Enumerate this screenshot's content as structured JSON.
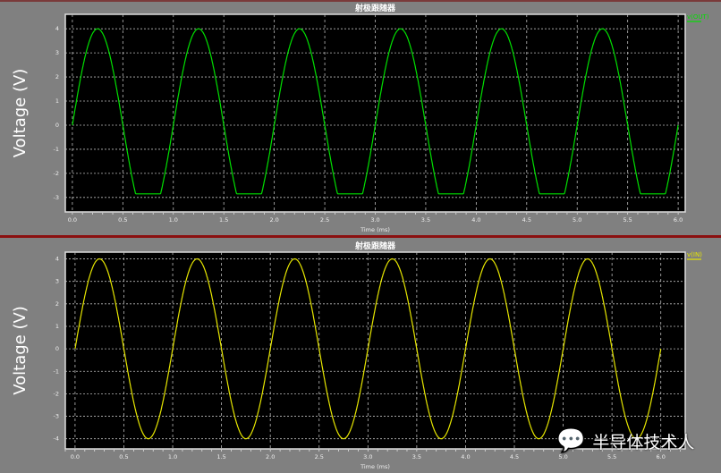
{
  "chart_data": [
    {
      "type": "line",
      "title": "射极跟随器",
      "xlabel": "Time (ms)",
      "ylabel": "Voltage (V)",
      "xlim": [
        -0.07,
        6.07
      ],
      "ylim": [
        -3.6,
        4.6
      ],
      "xticks": [
        "0.0",
        "0.5",
        "1.0",
        "1.5",
        "2.0",
        "2.5",
        "3.0",
        "3.5",
        "4.0",
        "4.5",
        "5.0",
        "5.5",
        "6.0"
      ],
      "yticks": [
        "4",
        "3",
        "2",
        "1",
        "0",
        "-1",
        "-2",
        "-3"
      ],
      "grid": true,
      "legend_position": "top-right",
      "series": [
        {
          "name": "v(OUT)",
          "color": "#00e000",
          "amplitude": 4,
          "frequency_khz": 1,
          "clip_min": -2.85
        }
      ]
    },
    {
      "type": "line",
      "title": "射极跟随器",
      "xlabel": "Time (ms)",
      "ylabel": "Voltage (V)",
      "xlim": [
        -0.1,
        6.25
      ],
      "ylim": [
        -4.45,
        4.3
      ],
      "xticks": [
        "0.0",
        "0.5",
        "1.0",
        "1.5",
        "2.0",
        "2.5",
        "3.0",
        "3.5",
        "4.0",
        "4.5",
        "5.0",
        "5.5",
        "6.0"
      ],
      "yticks": [
        "4",
        "3",
        "2",
        "1",
        "0",
        "-1",
        "-2",
        "-3",
        "-4"
      ],
      "grid": true,
      "legend_position": "top-right",
      "series": [
        {
          "name": "v(IN)",
          "color": "#e6e600",
          "amplitude": 4,
          "frequency_khz": 1
        }
      ]
    }
  ],
  "watermark": "半导体技术人"
}
